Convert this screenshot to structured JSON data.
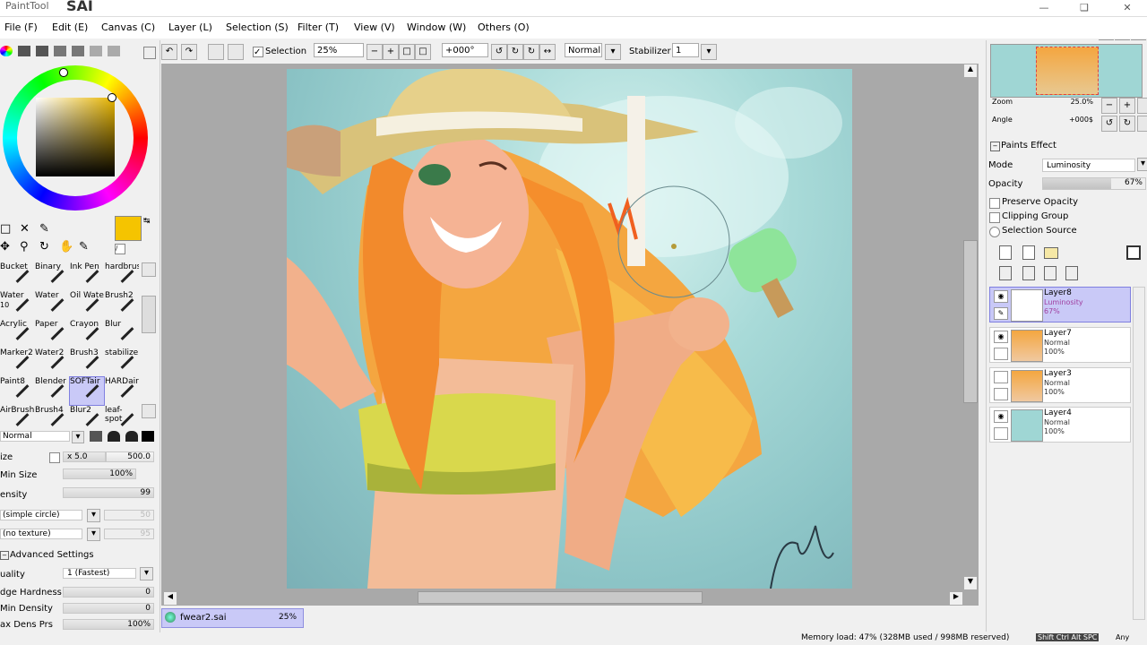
{
  "app": {
    "name": "PaintTool",
    "logo": "SAI"
  },
  "menu": [
    "File (F)",
    "Edit (E)",
    "Canvas (C)",
    "Layer (L)",
    "Selection (S)",
    "Filter (T)",
    "View (V)",
    "Window (W)",
    "Others (O)"
  ],
  "toolbar": {
    "selection_label": "Selection",
    "zoom": "25%",
    "angle": "+000°",
    "blend": "Normal",
    "stabilizer_label": "Stabilizer",
    "stabilizer_value": "1"
  },
  "brushes": [
    "Bucket",
    "Binary",
    "Ink Pen",
    "hardbrus",
    "Water",
    "Water",
    "Oil Wate",
    "Brush2",
    "Acrylic",
    "Paper",
    "Crayon",
    "Blur",
    "Marker2",
    "Water2",
    "Brush3",
    "stabilizer",
    "Paint8",
    "Blender",
    "SOFTair",
    "HARDair",
    "AirBrush",
    "Brush4",
    "Blur2",
    "leaf-spot"
  ],
  "brush_sub": {
    "water_size": "10"
  },
  "brush_settings": {
    "blend_mode": "Normal",
    "size_label": "ize",
    "size_mult": "x 5.0",
    "size_value": "500.0",
    "min_size_label": "Min Size",
    "min_size_value": "100%",
    "density_label": "ensity",
    "density_value": "99",
    "shape": "(simple circle)",
    "shape_value": "50",
    "texture": "(no texture)",
    "texture_value": "95",
    "advanced_label": "Advanced Settings",
    "quality_label": "uality",
    "quality_value": "1 (Fastest)",
    "edge_label": "dge Hardness",
    "edge_value": "0",
    "min_density_label": "Min Density",
    "min_density_value": "0",
    "max_dens_label": "ax Dens Prs",
    "max_dens_value": "100%"
  },
  "navigator": {
    "zoom_label": "Zoom",
    "zoom_value": "25.0%",
    "angle_label": "Angle",
    "angle_value": "+000$"
  },
  "layer_props": {
    "paints_effect": "Paints Effect",
    "mode_label": "Mode",
    "mode_value": "Luminosity",
    "opacity_label": "Opacity",
    "opacity_value": "67%",
    "opacity_fraction": 0.67,
    "preserve_opacity": "Preserve Opacity",
    "clipping_group": "Clipping Group",
    "selection_source": "Selection Source"
  },
  "layers": [
    {
      "name": "Layer8",
      "mode": "Luminosity",
      "opacity": "67%",
      "selected": true
    },
    {
      "name": "Layer7",
      "mode": "Normal",
      "opacity": "100%",
      "selected": false
    },
    {
      "name": "Layer3",
      "mode": "Normal",
      "opacity": "100%",
      "selected": false
    },
    {
      "name": "Layer4",
      "mode": "Normal",
      "opacity": "100%",
      "selected": false
    }
  ],
  "document_tab": {
    "name": "fwear2.sai",
    "zoom": "25%"
  },
  "status": {
    "memory": "Memory load: 47% (328MB used / 998MB reserved)",
    "keys": "Shift Ctrl Alt SPC",
    "caps": "Any"
  },
  "colors": {
    "primary": "#f5c400",
    "secondary": "#ffffff",
    "selected_layer": "#c9c9f7"
  }
}
